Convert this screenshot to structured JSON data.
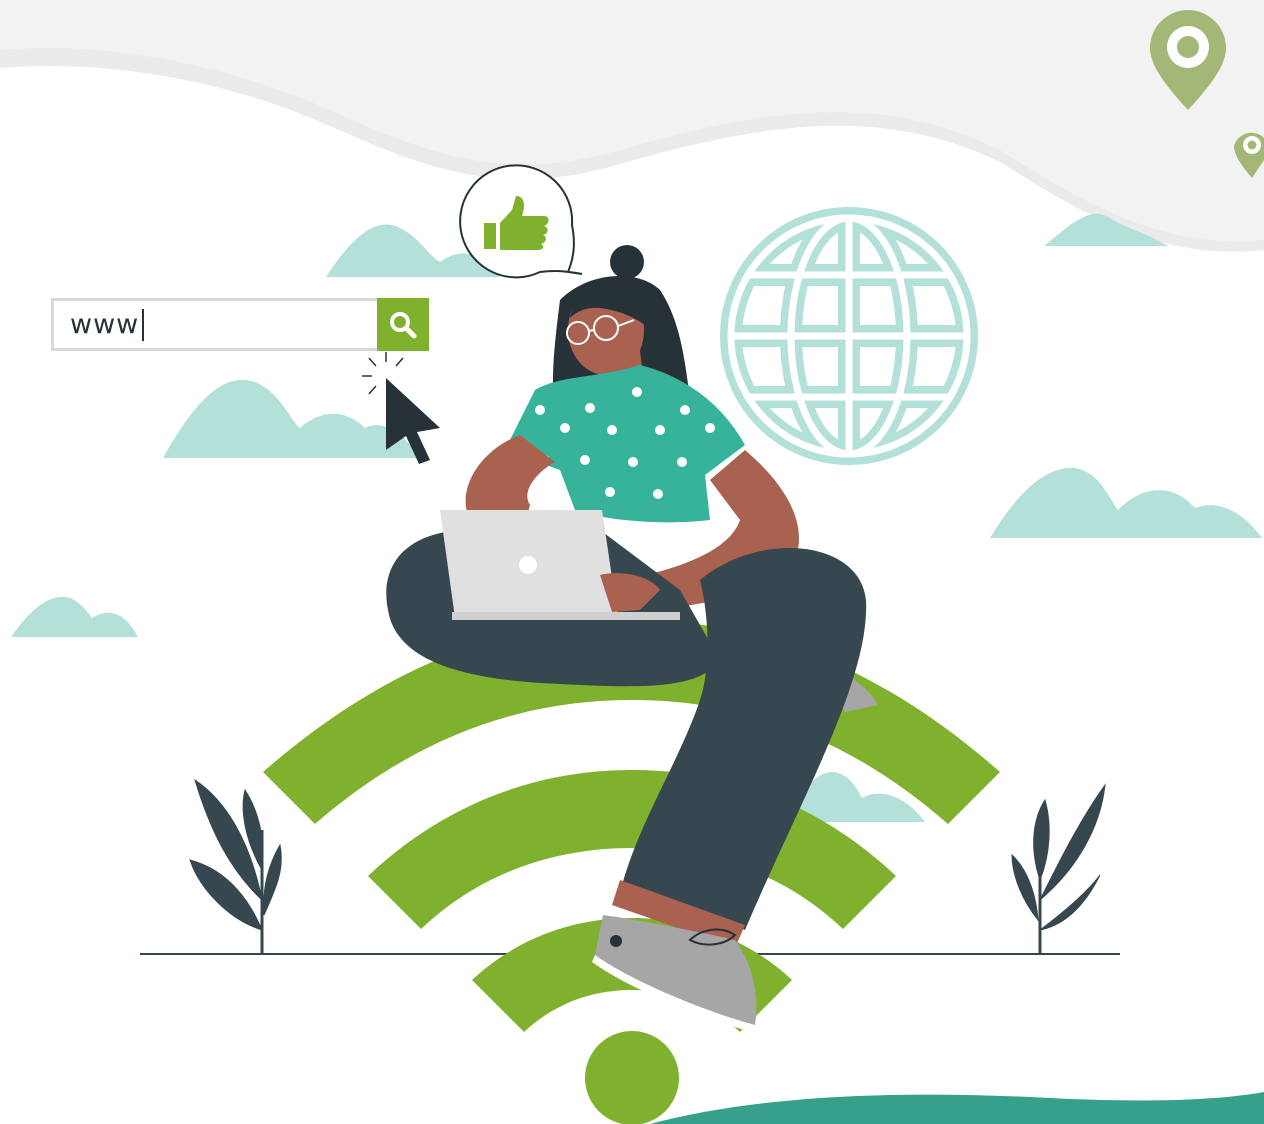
{
  "search": {
    "value": "www",
    "button_icon": "magnifier-icon"
  },
  "icons": {
    "thumbs_up": "thumbs-up-icon",
    "globe": "globe-icon",
    "wifi": "wifi-icon",
    "cursor": "mouse-cursor-icon",
    "location_pins": [
      "location-pin-icon",
      "location-pin-icon"
    ]
  },
  "colors": {
    "accent_green": "#7fb12f",
    "shirt_teal": "#36b39a",
    "cloud": "#b3e0d9",
    "dark": "#37474f",
    "skin": "#a8624f",
    "pin_green": "#a3b876"
  }
}
